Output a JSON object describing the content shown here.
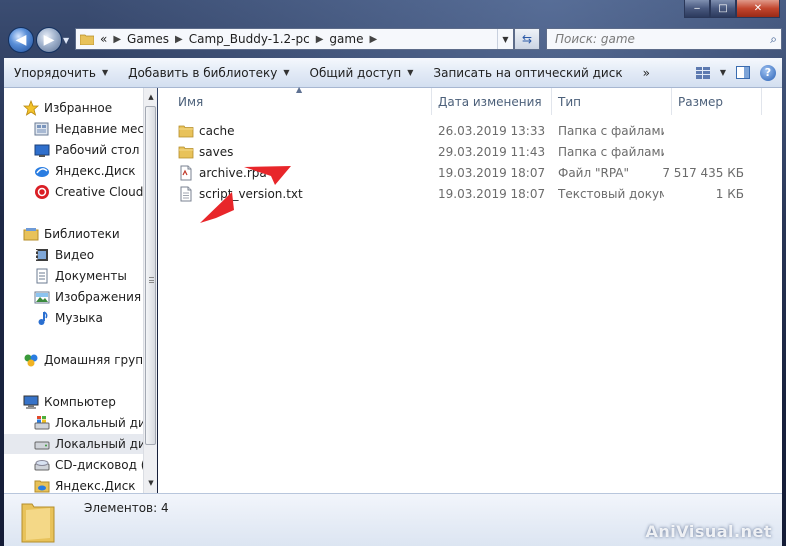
{
  "window": {
    "caption_buttons": {
      "minimize": "‒",
      "maximize": "□",
      "close": "✕"
    }
  },
  "address_bar": {
    "overflow": "«",
    "crumbs": [
      "Games",
      "Camp_Buddy-1.2-pc",
      "game"
    ]
  },
  "search": {
    "placeholder": "Поиск: game"
  },
  "toolbar": {
    "organize": "Упорядочить",
    "add_to_library": "Добавить в библиотеку",
    "share": "Общий доступ",
    "burn": "Записать на оптический диск",
    "more": "»",
    "help": "?"
  },
  "nav_pane": {
    "favorites": {
      "header": "Избранное",
      "items": [
        "Недавние места",
        "Рабочий стол",
        "Яндекс.Диск",
        "Creative Cloud Files"
      ]
    },
    "libraries": {
      "header": "Библиотеки",
      "items": [
        "Видео",
        "Документы",
        "Изображения",
        "Музыка"
      ]
    },
    "homegroup": "Домашняя группа",
    "computer": {
      "header": "Компьютер",
      "items": [
        "Локальный диск (C:)",
        "Локальный диск (D:)",
        "CD-дисковод (F:)",
        "Яндекс.Диск"
      ]
    }
  },
  "columns": {
    "name": "Имя",
    "date": "Дата изменения",
    "type": "Тип",
    "size": "Размер"
  },
  "files": [
    {
      "name": "cache",
      "date": "26.03.2019 13:33",
      "type": "Папка с файлами",
      "size": "",
      "icon": "folder-icon"
    },
    {
      "name": "saves",
      "date": "29.03.2019 11:43",
      "type": "Папка с файлами",
      "size": "",
      "icon": "folder-icon"
    },
    {
      "name": "archive.rpa",
      "date": "19.03.2019 18:07",
      "type": "Файл \"RPA\"",
      "size": "7 517 435 КБ",
      "icon": "rpa-file-icon"
    },
    {
      "name": "script_version.txt",
      "date": "19.03.2019 18:07",
      "type": "Текстовый документ",
      "size": "1 КБ",
      "icon": "text-file-icon"
    }
  ],
  "details": {
    "count": "Элементов: 4"
  },
  "watermark": "AniVisual.net",
  "colors": {
    "accent": "#e8262a",
    "folder": "#e8c25a"
  }
}
